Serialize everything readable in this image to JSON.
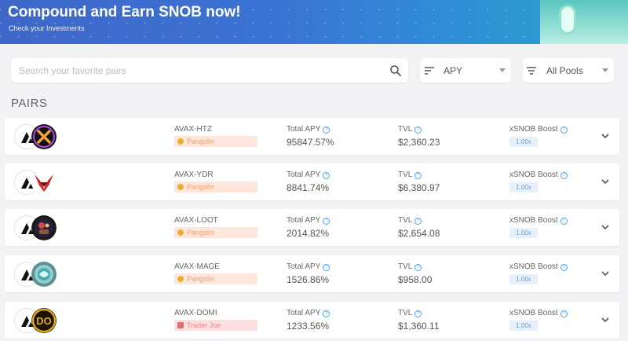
{
  "banner": {
    "title": "Compound and Earn SNOB now!",
    "subtitle": "Check your Investments"
  },
  "search": {
    "placeholder": "Search your favorite pairs"
  },
  "sort_select": {
    "value": "APY",
    "icon": "sort-icon"
  },
  "pool_select": {
    "value": "All Pools",
    "icon": "filter-icon"
  },
  "section_title": "PAIRS",
  "columns": {
    "apy": "Total APY",
    "tvl": "TVL",
    "boost": "xSNOB Boost"
  },
  "colors": {
    "pangolin_badge": "#fde7dd",
    "traderjoe_badge": "#fde0e0",
    "boost_badge": "#e6f0fb",
    "help_icon": "#4aa3ff"
  },
  "pairs": [
    {
      "name": "AVAX-HTZ",
      "dex": "Pangolin",
      "apy": "95847.57%",
      "tvl": "$2,360.23",
      "boost": "1.00x",
      "token_icon": "htz-token-icon"
    },
    {
      "name": "AVAX-YDR",
      "dex": "Pangolin",
      "apy": "8841.74%",
      "tvl": "$6,380.97",
      "boost": "1.00x",
      "token_icon": "ydr-token-icon"
    },
    {
      "name": "AVAX-LOOT",
      "dex": "Pangolin",
      "apy": "2014.82%",
      "tvl": "$2,654.08",
      "boost": "1.00x",
      "token_icon": "loot-token-icon"
    },
    {
      "name": "AVAX-MAGE",
      "dex": "Pangolin",
      "apy": "1526.86%",
      "tvl": "$958.00",
      "boost": "1.00x",
      "token_icon": "mage-token-icon"
    },
    {
      "name": "AVAX-DOMI",
      "dex": "Trader Joe",
      "apy": "1233.56%",
      "tvl": "$1,360.11",
      "boost": "1.00x",
      "token_icon": "domi-token-icon"
    }
  ]
}
